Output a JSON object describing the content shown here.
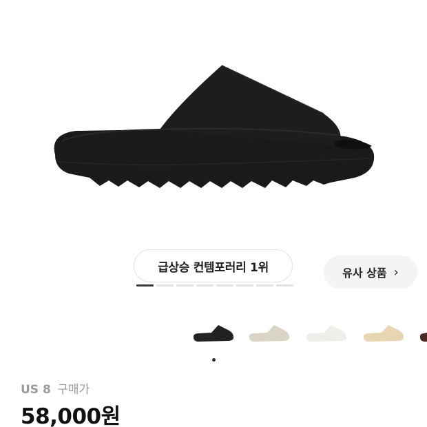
{
  "product": {
    "image_icon": "slide-sandal-image",
    "main_color": "#1d1d1d"
  },
  "ranking": {
    "label": "급상승 컨템포러리 1위",
    "active_index": 0,
    "total": 8
  },
  "similar_button": {
    "label": "유사 상품",
    "icon": "chevron-right-icon",
    "chevron": "›"
  },
  "color_options": [
    {
      "name": "black",
      "color": "#222222",
      "selected": true
    },
    {
      "name": "bone",
      "color": "#d9d4c6",
      "selected": false
    },
    {
      "name": "white",
      "color": "#eeeeea",
      "selected": false
    },
    {
      "name": "sand",
      "color": "#e8d6b2",
      "selected": false
    },
    {
      "name": "brown",
      "color": "#4a2a22",
      "selected": false
    }
  ],
  "purchase": {
    "size": "US 8",
    "size_label": "구매가",
    "price": "58,000원"
  }
}
